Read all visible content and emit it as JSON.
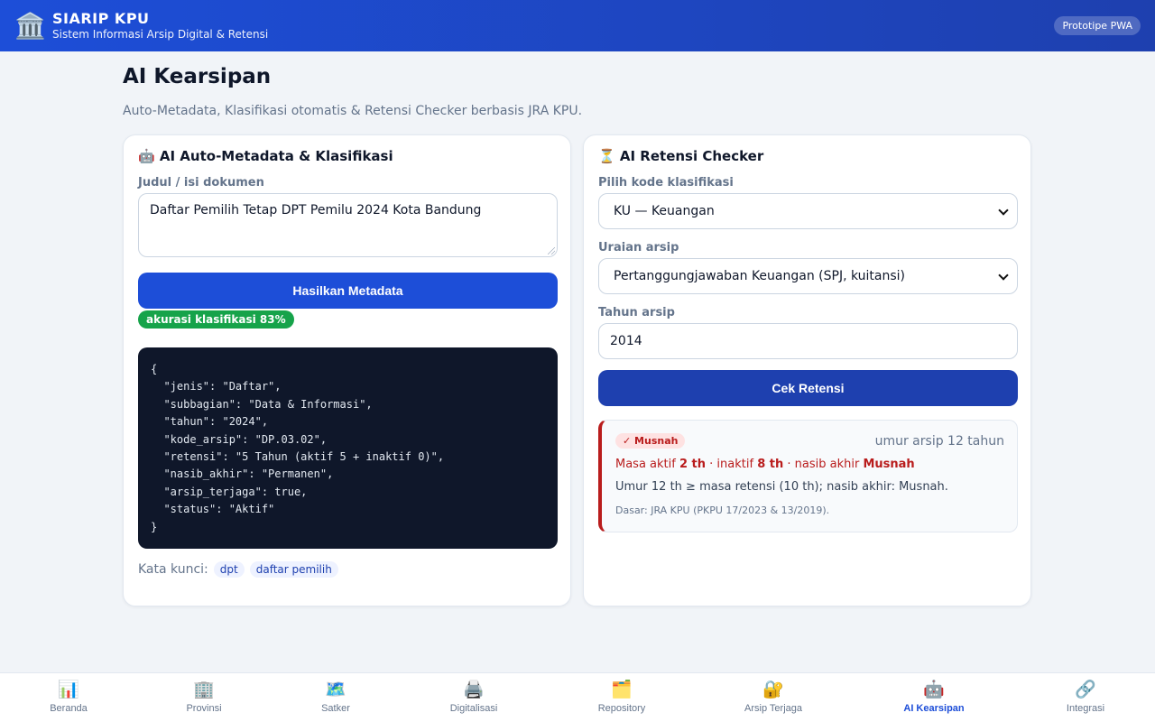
{
  "app": {
    "title": "SIARIP KPU",
    "subtitle": "Sistem Informasi Arsip Digital & Retensi",
    "badge": "Prototipe PWA",
    "logo_icon": "🏛️"
  },
  "page": {
    "title": "AI Kearsipan",
    "subtitle": "Auto-Metadata, Klasifikasi otomatis & Retensi Checker berbasis JRA KPU."
  },
  "metadata_card": {
    "title": "🤖 AI Auto-Metadata & Klasifikasi",
    "input_label": "Judul / isi dokumen",
    "input_value": "Daftar Pemilih Tetap DPT Pemilu 2024 Kota Bandung",
    "button_label": "Hasilkan Metadata",
    "accuracy_badge": "akurasi klasifikasi 83%",
    "json_output": "{\n  \"jenis\": \"Daftar\",\n  \"subbagian\": \"Data & Informasi\",\n  \"tahun\": \"2024\",\n  \"kode_arsip\": \"DP.03.02\",\n  \"retensi\": \"5 Tahun (aktif 5 + inaktif 0)\",\n  \"nasib_akhir\": \"Permanen\",\n  \"arsip_terjaga\": true,\n  \"status\": \"Aktif\"\n}",
    "keywords_label": "Kata kunci:",
    "keywords": [
      "dpt",
      "daftar pemilih"
    ]
  },
  "retensi_card": {
    "title": "⏳ AI Retensi Checker",
    "kode_label": "Pilih kode klasifikasi",
    "kode_value": "KU — Keuangan",
    "uraian_label": "Uraian arsip",
    "uraian_value": "Pertanggungjawaban Keuangan (SPJ, kuitansi)",
    "tahun_label": "Tahun arsip",
    "tahun_value": "2014",
    "button_label": "Cek Retensi",
    "result": {
      "badge": "✓ Musnah",
      "age": "umur arsip 12 tahun",
      "line1_prefix": "Masa aktif ",
      "aktif": "2 th",
      "line1_mid": " · inaktif ",
      "inaktif": "8 th",
      "line1_mid2": " · nasib akhir ",
      "nasib": "Musnah",
      "line2": "Umur 12 th ≥ masa retensi (10 th); nasib akhir: Musnah.",
      "line3": "Dasar: JRA KPU (PKPU 17/2023 & 13/2019)."
    }
  },
  "nav": [
    {
      "label": "Beranda",
      "icon": "📊"
    },
    {
      "label": "Provinsi",
      "icon": "🏢"
    },
    {
      "label": "Satker",
      "icon": "🗺️"
    },
    {
      "label": "Digitalisasi",
      "icon": "🖨️"
    },
    {
      "label": "Repository",
      "icon": "🗂️"
    },
    {
      "label": "Arsip Terjaga",
      "icon": "🔐"
    },
    {
      "label": "AI Kearsipan",
      "icon": "🤖"
    },
    {
      "label": "Integrasi",
      "icon": "🔗"
    }
  ],
  "colors": {
    "primary": "#1d4ed8",
    "success": "#16a34a",
    "danger": "#b91c1c"
  }
}
